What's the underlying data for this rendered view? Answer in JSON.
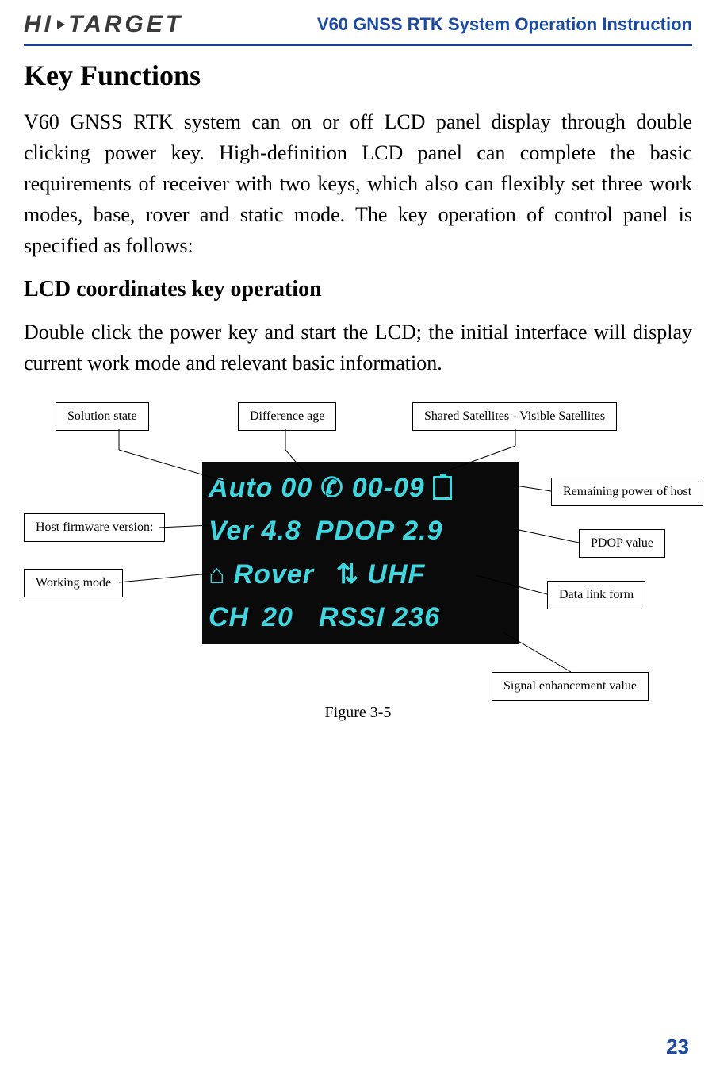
{
  "header": {
    "brand_prefix": "HI",
    "brand_suffix": "TARGET",
    "doc_title": "V60 GNSS RTK System Operation Instruction"
  },
  "section": {
    "title": "Key Functions",
    "para1": "V60 GNSS RTK system can on or off LCD panel display through double clicking power key. High-definition LCD panel can complete the basic requirements of receiver with two keys, which also can flexibly set three work modes, base, rover and static mode. The key operation of control panel is specified as follows:",
    "subtitle": "LCD coordinates key operation",
    "para2": "Double click the power key and start the LCD; the initial interface will display current work mode and relevant basic information."
  },
  "callouts": {
    "solution_state": "Solution state",
    "difference_age": "Difference age",
    "shared_sats": "Shared Satellites - Visible Satellites",
    "remaining_power": "Remaining power of host",
    "firmware": "Host firmware version:",
    "pdop": "PDOP value",
    "working_mode": "Working mode",
    "data_link": "Data link form",
    "signal_enh": "Signal enhancement value"
  },
  "lcd": {
    "row1_solution": "Auto",
    "row1_age": "00",
    "row1_sats": "00-09",
    "row2_ver_label": "Ver",
    "row2_ver_value": "4.8",
    "row2_pdop_label": "PDOP",
    "row2_pdop_value": "2.9",
    "row3_mode": "Rover",
    "row3_link": "UHF",
    "row4_ch_label": "CH",
    "row4_ch_value": "20",
    "row4_rssi_label": "RSSI",
    "row4_rssi_value": "236"
  },
  "figure_caption": "Figure 3-5",
  "page_number": "23"
}
